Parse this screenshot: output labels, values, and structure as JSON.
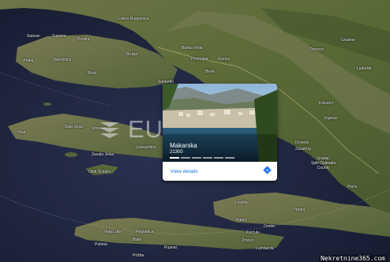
{
  "map": {
    "labels": {
      "lokva_rogoznica": "Lokva\nRogoznica",
      "sutivan": "Sutivan",
      "supetar": "Supetar",
      "postira": "Postira",
      "nerezisca": "Nerežišća",
      "brac": "Brač",
      "sumartin": "Sumartin",
      "baska_voda": "Baška Voda",
      "promajna": "Promajna",
      "zagvozd_area": "Kozica",
      "hvar": "Hvar",
      "stari_grad": "Stari Grad",
      "vrboska": "Vrboska",
      "zastrazisce": "Zastražišće",
      "zavala": "Zavala Jelsa",
      "otok_scedro": "Otok Šćedro",
      "drvenik": "Drvenik",
      "zaostrog": "Zaostrog",
      "vrgorac": "Vrgorac",
      "gradac": "Gradac\nSplit-Dalmatia\nCounty",
      "ploce": "Ploče",
      "loviste": "Lovište",
      "trpanj": "Trpanj",
      "viganj": "Viganj",
      "orebic": "Orebić",
      "korcula": "Korčula",
      "zrnovo": "Žrnovo",
      "vela_luka": "Vela Luka",
      "prigradica": "Prigradica",
      "blato": "Blato",
      "potirna": "Potirna",
      "lumbarda": "Lumbarda",
      "pupnat": "Pupnat",
      "proizd": "Prižba",
      "brela": "Brela",
      "imotski": "Grubine",
      "drinovci": "Drinovci",
      "ljubuski": "Ljubuški",
      "vrbanj": "Vrbanj",
      "brusje": "Brusje",
      "kokorici": "Kokorići"
    }
  },
  "watermark": {
    "text": "EUROVILLA"
  },
  "card": {
    "title": "Makarska",
    "postcode": "21300",
    "link": "View details",
    "photo_count": 6,
    "active_photo": 0
  },
  "credit": "Nekretnine365.com",
  "colors": {
    "sea": "#1c2236",
    "land": "#5b6a3a",
    "link": "#1a73e8"
  }
}
